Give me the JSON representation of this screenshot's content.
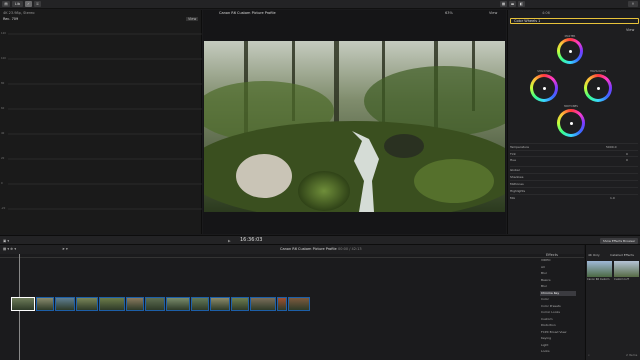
{
  "app": {
    "library_label": "Lib",
    "breadcrumb": "4K 23.98p, Stereo",
    "project_title": "Canon R6 Custom Picture Profile",
    "zoom": "63%",
    "view_label": "View",
    "inspector_duration": "4:06"
  },
  "scope": {
    "title": "Rec. 709",
    "view_label": "View",
    "scale_labels": [
      "120",
      "100",
      "80",
      "60",
      "40",
      "20",
      "0",
      "-20"
    ]
  },
  "inspector": {
    "effect_name": "Color Wheels 1",
    "view_label": "View",
    "wheels": [
      {
        "label": "MASTER"
      },
      {
        "label": "SHADOWS"
      },
      {
        "label": "HIGHLIGHTS"
      },
      {
        "label": "MIDTONES"
      }
    ],
    "params": [
      {
        "label": "Temperature",
        "value": "5000.0"
      },
      {
        "label": "Tint",
        "value": "0"
      },
      {
        "label": "Hue",
        "value": "0"
      }
    ],
    "sections": [
      "Global",
      "Shadows",
      "Midtones",
      "Highlights"
    ],
    "mix_label": "Mix",
    "mix_value": "1.0"
  },
  "transport": {
    "timecode": "16:36:03",
    "timeline_title": "Canon R6 Custom Picture Profile",
    "timeline_duration": "00:00 / 42:13",
    "effects_browser_btn": "Show Effects Browser"
  },
  "effects": {
    "title": "Effects",
    "tabs": [
      "4K Only",
      "Installed Effects"
    ],
    "categories": [
      "VIDEO",
      "All",
      "Blur",
      "Basics",
      "Blur",
      "Chroma Key",
      "Color",
      "Color Presets",
      "Comic Looks",
      "Custom",
      "Distortion",
      "FCPX Broad View",
      "Keying",
      "Light",
      "Looks"
    ],
    "selected_index": 5,
    "thumbs": [
      "Canon R6 Custom",
      "Custom LUT"
    ],
    "count": "2 Items"
  },
  "colors": {
    "accent_yellow": "#e8c33a",
    "clip_blue": "#1d5fa8",
    "selected_clip": "#ffffff"
  },
  "clips": [
    {
      "name": "clip-1"
    },
    {
      "name": "clip-2"
    },
    {
      "name": "clip-3"
    },
    {
      "name": "clip-4"
    },
    {
      "name": "clip-5"
    },
    {
      "name": "clip-6"
    },
    {
      "name": "clip-7"
    },
    {
      "name": "clip-8"
    },
    {
      "name": "clip-9"
    },
    {
      "name": "clip-10"
    },
    {
      "name": "clip-11"
    },
    {
      "name": "clip-12"
    },
    {
      "name": "clip-13"
    },
    {
      "name": "clip-14"
    }
  ]
}
